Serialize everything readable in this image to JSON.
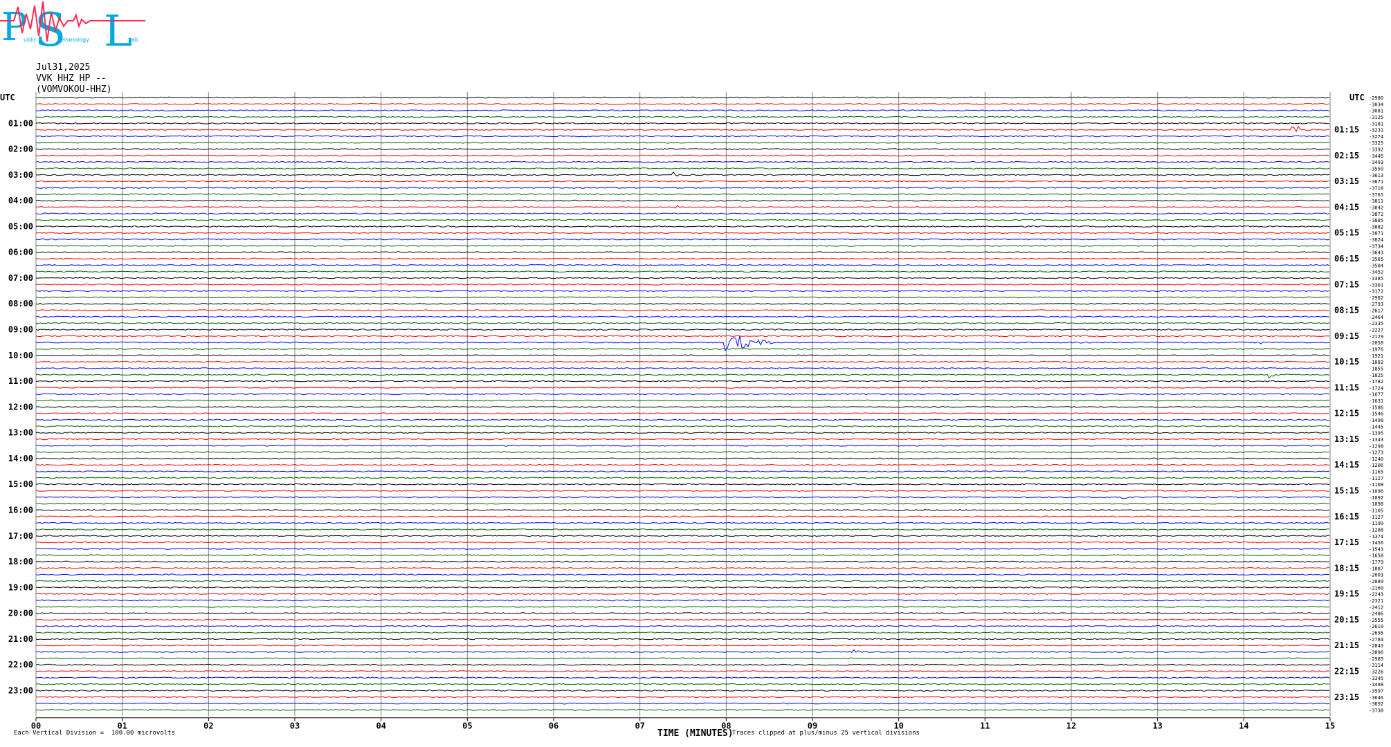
{
  "logo": {
    "letters": [
      "P",
      "S",
      "L"
    ],
    "small_text": [
      "ublic",
      "eismology",
      "ab"
    ]
  },
  "header": {
    "date": "Jul31,2025",
    "station": "VVK HHZ HP --",
    "name": "(VOMVOKOU-HHZ)"
  },
  "colors": {
    "trace_black": "#000000",
    "trace_red": "#ff0000",
    "trace_blue": "#0000ff",
    "trace_green": "#006400",
    "grid": "#808080",
    "logo_cyan": "#00a8e0",
    "logo_red": "#ff2a55"
  },
  "chart_data": {
    "type": "helicorder",
    "xlabel": "TIME (MINUTES)",
    "x_ticks": [
      "00",
      "01",
      "02",
      "03",
      "04",
      "05",
      "06",
      "07",
      "08",
      "09",
      "10",
      "11",
      "12",
      "13",
      "14",
      "15"
    ],
    "xlim": [
      0,
      15
    ],
    "rows_per_hour": 4,
    "row_minutes": 15,
    "trace_color_cycle": [
      "black",
      "red",
      "blue",
      "green"
    ],
    "left_label_header": "UTC",
    "right_label_header": "UTC",
    "left_labels": [
      "01:00",
      "02:00",
      "03:00",
      "04:00",
      "05:00",
      "06:00",
      "07:00",
      "08:00",
      "09:00",
      "10:00",
      "11:00",
      "12:00",
      "13:00",
      "14:00",
      "15:00",
      "16:00",
      "17:00",
      "18:00",
      "19:00",
      "20:00",
      "21:00",
      "22:00",
      "23:00"
    ],
    "right_labels": [
      "01:15",
      "02:15",
      "03:15",
      "04:15",
      "05:15",
      "06:15",
      "07:15",
      "08:15",
      "09:15",
      "10:15",
      "11:15",
      "12:15",
      "13:15",
      "14:15",
      "15:15",
      "16:15",
      "17:15",
      "18:15",
      "19:15",
      "20:15",
      "21:15",
      "22:15",
      "23:15"
    ],
    "right_offsets": [
      "-2980",
      "-3034",
      "-3081",
      "-3125",
      "-3181",
      "-3231",
      "-3274",
      "-3325",
      "-3392",
      "-3445",
      "-3493",
      "-3550",
      "-3613",
      "-3671",
      "-3718",
      "-3765",
      "-3811",
      "-3842",
      "-3872",
      "-3885",
      "-3882",
      "-3871",
      "-3824",
      "-3734",
      "-3643",
      "-3565",
      "-3504",
      "-3452",
      "-3385",
      "-3301",
      "-3172",
      "-2982",
      "-2793",
      "-2617",
      "-2464",
      "-2335",
      "-2227",
      "-2129",
      "-2058",
      "-1976",
      "-1921",
      "-1882",
      "-1855",
      "-1825",
      "-1782",
      "-1724",
      "-1677",
      "-1631",
      "-1586",
      "-1546",
      "-1498",
      "-1445",
      "-1395",
      "-1343",
      "-1298",
      "-1273",
      "-1240",
      "-1206",
      "-1165",
      "-1127",
      "-1108",
      "-1096",
      "-1092",
      "-1098",
      "-1105",
      "-1127",
      "-1199",
      "-1288",
      "-1374",
      "-1456",
      "-1543",
      "-1658",
      "-1779",
      "-1887",
      "-2003",
      "-2089",
      "-2160",
      "-2243",
      "-2321",
      "-2412",
      "-2486",
      "-2555",
      "-2619",
      "-2695",
      "-2784",
      "-2843",
      "-2896",
      "-2985",
      "-3114",
      "-3226",
      "-3345",
      "-3498",
      "-3597",
      "-3646",
      "-3692",
      "-3738"
    ],
    "events": [
      {
        "row": 5,
        "minute": 14.6,
        "amplitude": "moderate"
      },
      {
        "row": 12,
        "minute": 7.4,
        "amplitude": "small"
      },
      {
        "row": 17,
        "minute": 7.4,
        "amplitude": "small"
      },
      {
        "row": 38,
        "minute": 8.1,
        "amplitude": "large"
      },
      {
        "row": 38,
        "minute": 14.2,
        "amplitude": "small"
      },
      {
        "row": 43,
        "minute": 14.3,
        "amplitude": "small"
      },
      {
        "row": 62,
        "minute": 12.6,
        "amplitude": "small"
      },
      {
        "row": 86,
        "minute": 9.5,
        "amplitude": "small"
      }
    ],
    "footer_left": "Each Vertical Division =  100.00 microvolts",
    "footer_right": "Traces clipped at plus/minus 25 vertical divisions"
  }
}
